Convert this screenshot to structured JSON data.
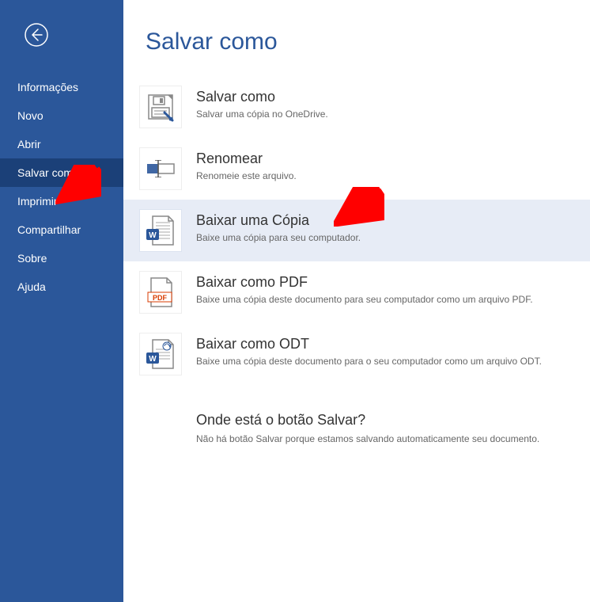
{
  "page_title": "Salvar como",
  "sidebar": {
    "items": [
      {
        "label": "Informações"
      },
      {
        "label": "Novo"
      },
      {
        "label": "Abrir"
      },
      {
        "label": "Salvar como",
        "selected": true
      },
      {
        "label": "Imprimir"
      },
      {
        "label": "Compartilhar"
      },
      {
        "label": "Sobre"
      },
      {
        "label": "Ajuda"
      }
    ]
  },
  "options": [
    {
      "title": "Salvar como",
      "desc": "Salvar uma cópia no OneDrive.",
      "icon": "save-as-icon",
      "highlight": false
    },
    {
      "title": "Renomear",
      "desc": "Renomeie este arquivo.",
      "icon": "rename-icon",
      "highlight": false
    },
    {
      "title": "Baixar uma Cópia",
      "desc": "Baixe uma cópia para seu computador.",
      "icon": "download-copy-icon",
      "highlight": true
    },
    {
      "title": "Baixar como PDF",
      "desc": "Baixe uma cópia deste documento para seu computador como um arquivo PDF.",
      "icon": "download-pdf-icon",
      "highlight": false
    },
    {
      "title": "Baixar como ODT",
      "desc": "Baixe uma cópia deste documento para o seu computador como um arquivo ODT.",
      "icon": "download-odt-icon",
      "highlight": false
    }
  ],
  "footer": {
    "title": "Onde está o botão Salvar?",
    "desc": "Não há botão Salvar porque estamos salvando automaticamente seu documento."
  },
  "colors": {
    "brand": "#2b579a",
    "sidebar_selected": "#1b4078",
    "highlight_bg": "#e7ecf6",
    "arrow": "#ff0000"
  }
}
